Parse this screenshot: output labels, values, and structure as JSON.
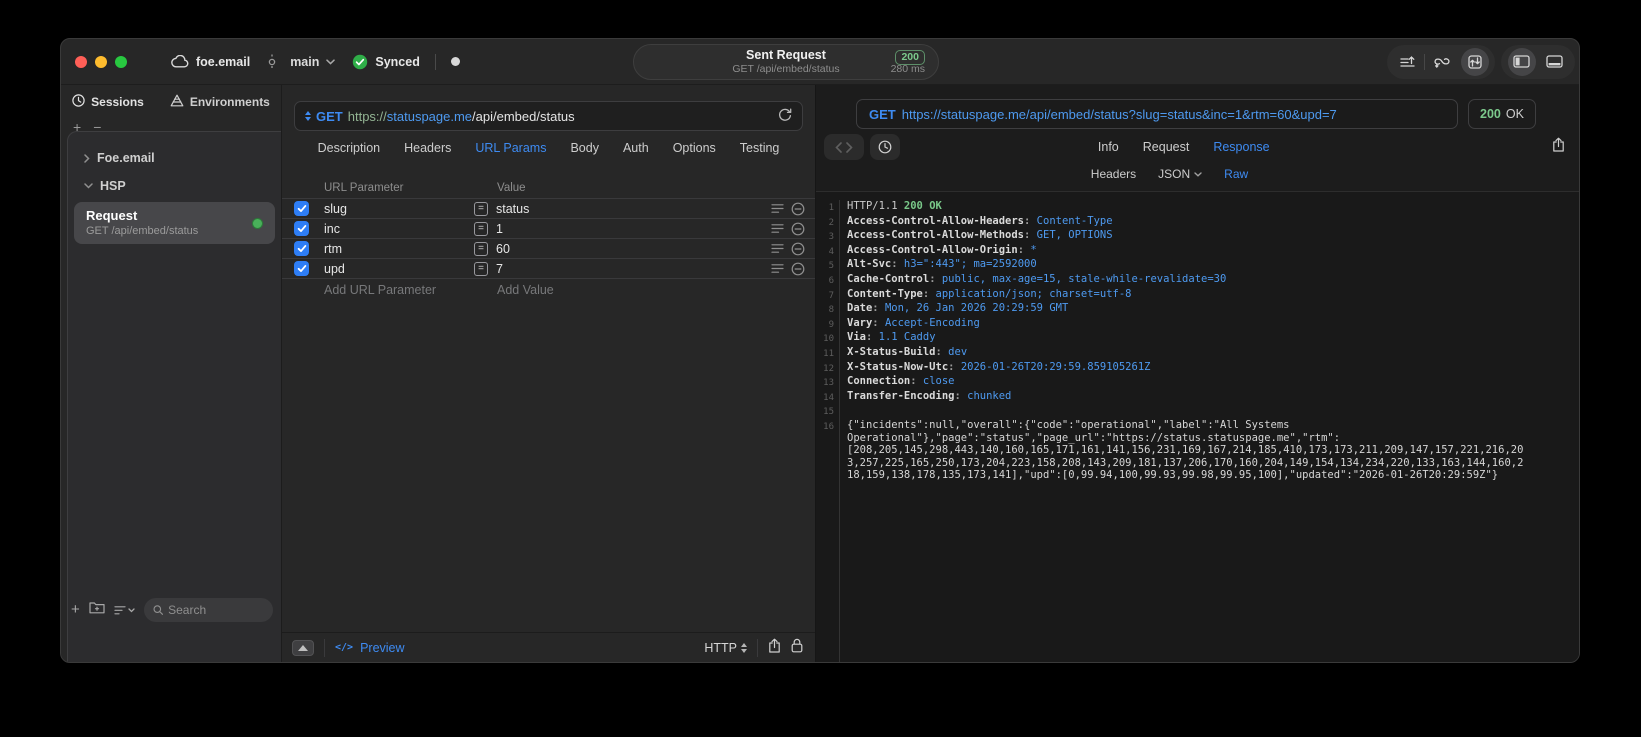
{
  "colors": {
    "accent_blue": "#3E8BF2",
    "link_blue": "#4E9AF0",
    "status_green": "#7CC98C",
    "checkbox_blue": "#2E7EF6",
    "dot_green": "#49B05A"
  },
  "titlebar": {
    "project": "foe.email",
    "branch": "main",
    "sync_label": "Synced",
    "request_summary": {
      "title": "Sent Request",
      "subtitle": "GET /api/embed/status",
      "status_code": "200",
      "duration": "280 ms"
    }
  },
  "sidebar": {
    "tabs": [
      {
        "label": "Sessions"
      },
      {
        "label": "Environments"
      }
    ],
    "add_label": "+",
    "remove_label": "−",
    "tree": {
      "groups": [
        {
          "label": "Foe.email"
        },
        {
          "label": "HSP"
        }
      ]
    },
    "request_item": {
      "title": "Request",
      "subtitle": "GET /api/embed/status"
    },
    "footer_add_label": "+",
    "search_placeholder": "Search"
  },
  "request_panel": {
    "method": "GET",
    "url": {
      "scheme": "https://",
      "host": "statuspage.me",
      "path": "/api/embed/status"
    },
    "tabs": [
      "Description",
      "Headers",
      "URL Params",
      "Body",
      "Auth",
      "Options",
      "Testing"
    ],
    "active_tab": "URL Params",
    "params": {
      "columns": [
        "URL Parameter",
        "Value"
      ],
      "equals_symbol": "=",
      "rows": [
        {
          "name": "slug",
          "value": "status",
          "checked": true
        },
        {
          "name": "inc",
          "value": "1",
          "checked": true
        },
        {
          "name": "rtm",
          "value": "60",
          "checked": true
        },
        {
          "name": "upd",
          "value": "7",
          "checked": true
        }
      ],
      "add_name_placeholder": "Add URL Parameter",
      "add_value_placeholder": "Add Value"
    },
    "footer": {
      "preview_icon": "</>",
      "preview_label": "Preview",
      "protocol": "HTTP"
    }
  },
  "response_panel": {
    "method": "GET",
    "url": "https://statuspage.me/api/embed/status?slug=status&inc=1&rtm=60&upd=7",
    "status_code": "200",
    "status_text": "OK",
    "tabs": [
      "Info",
      "Request",
      "Response"
    ],
    "active_tab": "Response",
    "subtabs": [
      "Headers",
      "JSON",
      "Raw"
    ],
    "active_subtab": "Raw",
    "raw": {
      "status_line": {
        "number": 1,
        "protocol": "HTTP/1.1",
        "status": "200 OK"
      },
      "headers": [
        {
          "number": 2,
          "name": "Access-Control-Allow-Headers",
          "value": "Content-Type"
        },
        {
          "number": 3,
          "name": "Access-Control-Allow-Methods",
          "value": "GET, OPTIONS"
        },
        {
          "number": 4,
          "name": "Access-Control-Allow-Origin",
          "value": "*"
        },
        {
          "number": 5,
          "name": "Alt-Svc",
          "value": "h3=\":443\"; ma=2592000"
        },
        {
          "number": 6,
          "name": "Cache-Control",
          "value": "public, max-age=15, stale-while-revalidate=30"
        },
        {
          "number": 7,
          "name": "Content-Type",
          "value": "application/json; charset=utf-8"
        },
        {
          "number": 8,
          "name": "Date",
          "value": "Mon, 26 Jan 2026 20:29:59 GMT"
        },
        {
          "number": 9,
          "name": "Vary",
          "value": "Accept-Encoding"
        },
        {
          "number": 10,
          "name": "Via",
          "value": "1.1 Caddy"
        },
        {
          "number": 11,
          "name": "X-Status-Build",
          "value": "dev"
        },
        {
          "number": 12,
          "name": "X-Status-Now-Utc",
          "value": "2026-01-26T20:29:59.859105261Z"
        },
        {
          "number": 13,
          "name": "Connection",
          "value": "close"
        },
        {
          "number": 14,
          "name": "Transfer-Encoding",
          "value": "chunked"
        }
      ],
      "blank_line_number": 15,
      "body_line_number": 16,
      "body": "{\"incidents\":null,\"overall\":{\"code\":\"operational\",\"label\":\"All Systems Operational\"},\"page\":\"status\",\"page_url\":\"https://status.statuspage.me\",\"rtm\":[208,205,145,298,443,140,160,165,171,161,141,156,231,169,167,214,185,410,173,173,211,209,147,157,221,216,203,257,225,165,250,173,204,223,158,208,143,209,181,137,206,170,160,204,149,154,134,234,220,133,163,144,160,218,159,138,178,135,173,141],\"upd\":[0,99.94,100,99.93,99.98,99.95,100],\"updated\":\"2026-01-26T20:29:59Z\"}"
    }
  }
}
